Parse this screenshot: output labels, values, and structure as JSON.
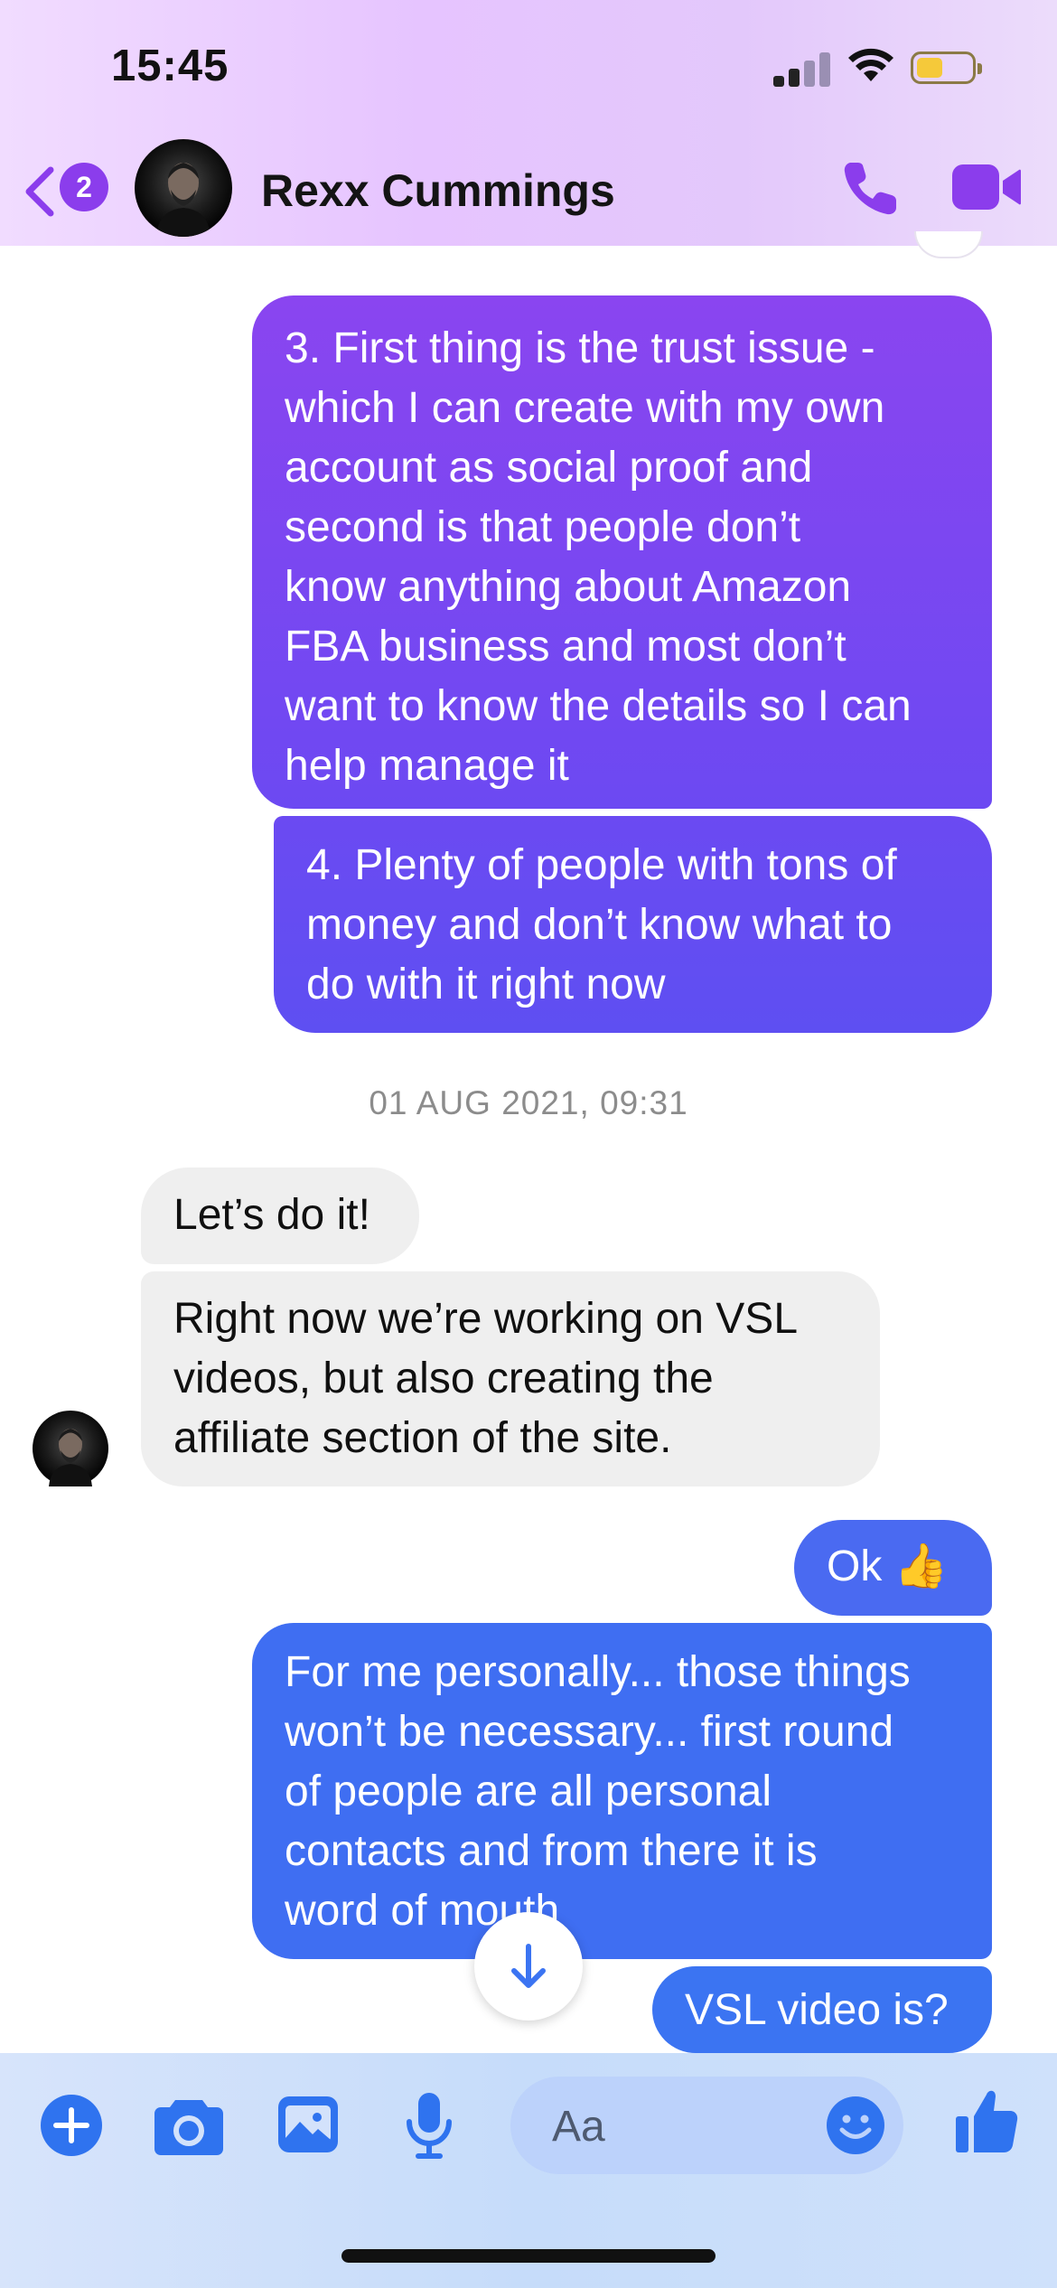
{
  "status_bar": {
    "time": "15:45"
  },
  "header": {
    "back_badge_count": "2",
    "contact_name": "Rexx Cummings",
    "icons": [
      "back-chevron-icon",
      "phone-icon",
      "video-camera-icon"
    ]
  },
  "conversation": {
    "messages_before": [
      {
        "direction": "outgoing",
        "text": "3. First thing is the trust issue -\nwhich I can create with my own\naccount as social proof and\nsecond is that people don’t\nknow anything about Amazon\nFBA business and most don’t\nwant to know the details so I can\nhelp manage it"
      },
      {
        "direction": "outgoing",
        "text": "4. Plenty of people with tons of\nmoney and don’t know what to\ndo with it right now"
      }
    ],
    "timestamp": "01 AUG 2021, 09:31",
    "messages_after": [
      {
        "direction": "incoming",
        "text": "Let’s do it!"
      },
      {
        "direction": "incoming",
        "text": "Right now we’re working on VSL\nvideos, but also creating the\naffiliate section of the site."
      },
      {
        "direction": "outgoing",
        "text": "Ok 👍"
      },
      {
        "direction": "outgoing",
        "text": "For me personally... those things\nwon’t be necessary... first round\nof people are all personal\ncontacts and from there it is\nword of mouth"
      },
      {
        "direction": "outgoing",
        "text": "VSL video is?"
      }
    ]
  },
  "composer": {
    "placeholder": "Aa",
    "tools": [
      "plus-icon",
      "camera-icon",
      "photo-icon",
      "microphone-icon",
      "emoji-icon",
      "thumbs-up-icon"
    ]
  },
  "colors": {
    "purple_accent": "#8b3dec",
    "outgoing_purple": "#7c45f3",
    "outgoing_blue": "#3f6ef2",
    "incoming_bg": "#efefef"
  }
}
